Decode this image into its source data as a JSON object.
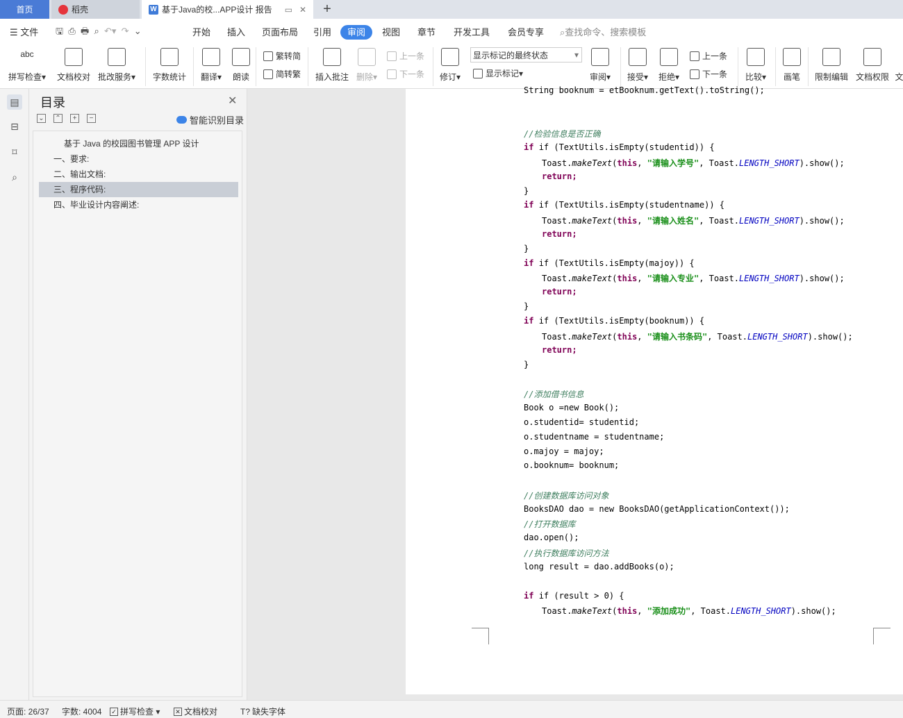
{
  "tabs": {
    "home": "首页",
    "daoke": "稻壳",
    "doc": "基于Java的校...APP设计 报告",
    "add": "+"
  },
  "menu": {
    "file": "文件",
    "items": [
      "开始",
      "插入",
      "页面布局",
      "引用",
      "审阅",
      "视图",
      "章节",
      "开发工具",
      "会员专享"
    ],
    "active": "审阅",
    "search_placeholder": "查找命令、搜索模板"
  },
  "ribbon": {
    "spell": "拼写检查",
    "proof": "文档校对",
    "review_service": "批改服务",
    "wordcount": "字数统计",
    "translate": "翻译",
    "read": "朗读",
    "trad": "繁转简",
    "simp": "简转繁",
    "insert_comment": "插入批注",
    "delete": "删除",
    "prev": "上一条",
    "next": "下一条",
    "track": "修订",
    "markup_select": "显示标记的最终状态",
    "show_markup": "显示标记",
    "review": "审阅",
    "accept": "接受",
    "reject": "拒绝",
    "prev2": "上一条",
    "next2": "下一条",
    "compare": "比较",
    "pen": "画笔",
    "restrict": "限制编辑",
    "rights": "文档权限",
    "more": "文"
  },
  "nav": {
    "title": "目录",
    "smart": "智能识别目录",
    "ctl": [
      "⌄",
      "⌃",
      "+",
      "−"
    ],
    "items": [
      "基于 Java 的校园图书管理 APP 设计",
      "一、要求:",
      "二、输出文档:",
      "三、程序代码:",
      "四、毕业设计内容阐述:"
    ]
  },
  "code": {
    "l0": "String booknum = etBooknum.getText().toString();",
    "c1": "//检验信息是否正确",
    "if1": "if (TextUtils.isEmpty(studentid)) {",
    "t1a": "Toast.",
    "t1b": "makeText",
    "t1c": "(",
    "t1d": "this",
    ", ": "",
    "t1e": "\"请输入学号\"",
    "t1f": ", Toast.",
    "t1g": "LENGTH_SHORT",
    "t1h": ").show();",
    "ret": "return;",
    "close": "}",
    "if2": "if (TextUtils.isEmpty(studentname)) {",
    "s2": "\"请输入姓名\"",
    "if3": "if (TextUtils.isEmpty(majoy)) {",
    "s3": "\"请输入专业\"",
    "if4": "if (TextUtils.isEmpty(booknum)) {",
    "s4": "\"请输入书条码\"",
    "c2": "//添加借书信息",
    "b1": "Book o =new Book();",
    "b2": "o.studentid= studentid;",
    "b3": "o.studentname = studentname;",
    "b4": "o.majoy = majoy;",
    "b5": "o.booknum= booknum;",
    "c3": "//创建数据库访问对象",
    "d1": "BooksDAO dao = new BooksDAO(getApplicationContext());",
    "c4": "//打开数据库",
    "d2": "dao.open();",
    "c5": "//执行数据库访问方法",
    "d3": "long result = dao.addBooks(o);",
    "if5": "if (result > 0) {",
    "s5": "\"添加成功\""
  },
  "status": {
    "page": "页面: 26/37",
    "words": "字数: 4004",
    "spell": "拼写检查",
    "proof": "文档校对",
    "font": "缺失字体"
  }
}
